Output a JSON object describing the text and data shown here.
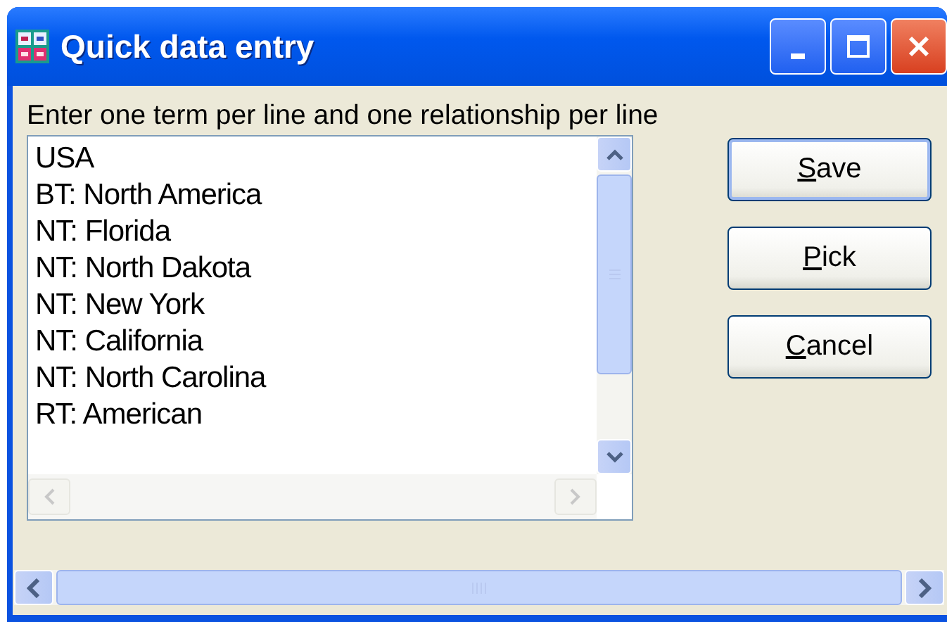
{
  "window": {
    "title": "Quick data entry"
  },
  "instruction": "Enter one term per line and one relationship per line",
  "entry_lines": [
    "USA",
    "BT: North America",
    "NT: Florida",
    "NT: North Dakota",
    "NT: New York",
    "NT: California",
    "NT: North Carolina",
    "RT: American"
  ],
  "buttons": [
    {
      "mnemonic": "S",
      "rest": "ave",
      "default": true
    },
    {
      "mnemonic": "P",
      "rest": "ick",
      "default": false
    },
    {
      "mnemonic": "C",
      "rest": "ancel",
      "default": false
    }
  ]
}
